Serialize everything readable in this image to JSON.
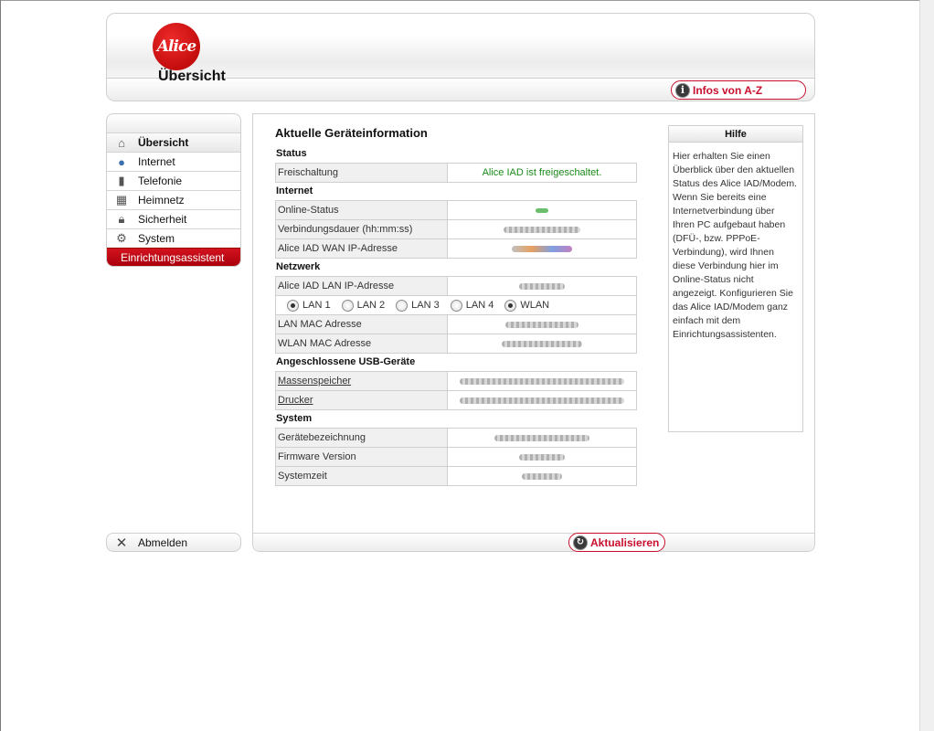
{
  "header": {
    "logo_text": "Alice",
    "page_title": "Übersicht",
    "infos_button": "Infos von A-Z"
  },
  "sidebar": {
    "items": [
      {
        "label": "Übersicht",
        "icon": "house-icon"
      },
      {
        "label": "Internet",
        "icon": "globe-icon"
      },
      {
        "label": "Telefonie",
        "icon": "phone-icon"
      },
      {
        "label": "Heimnetz",
        "icon": "network-icon"
      },
      {
        "label": "Sicherheit",
        "icon": "lock-icon"
      },
      {
        "label": "System",
        "icon": "gear-icon"
      }
    ],
    "assistant": "Einrichtungsassistent",
    "logout": "Abmelden"
  },
  "main": {
    "title": "Aktuelle Geräteinformation",
    "status": {
      "heading": "Status",
      "rows": [
        {
          "label": "Freischaltung",
          "value": "Alice IAD ist freigeschaltet."
        }
      ]
    },
    "internet": {
      "heading": "Internet",
      "rows": [
        {
          "label": "Online-Status"
        },
        {
          "label": "Verbindungsdauer (hh:mm:ss)"
        },
        {
          "label": "Alice IAD WAN IP-Adresse"
        }
      ]
    },
    "network": {
      "heading": "Netzwerk",
      "ip_label": "Alice IAD LAN IP-Adresse",
      "ports": [
        "LAN 1",
        "LAN 2",
        "LAN 3",
        "LAN 4",
        "WLAN"
      ],
      "selected_ports": [
        "LAN 1",
        "WLAN"
      ],
      "lan_mac": "LAN MAC Adresse",
      "wlan_mac": "WLAN MAC Adresse"
    },
    "usb": {
      "heading": "Angeschlossene USB-Geräte",
      "storage": "Massenspeicher",
      "printer": "Drucker"
    },
    "system": {
      "heading": "System",
      "rows": [
        {
          "label": "Gerätebezeichnung"
        },
        {
          "label": "Firmware Version"
        },
        {
          "label": "Systemzeit"
        }
      ]
    },
    "refresh_button": "Aktualisieren"
  },
  "help": {
    "title": "Hilfe",
    "text": "Hier erhalten Sie einen Überblick über den aktuellen Status des Alice IAD/Modem. Wenn Sie bereits eine Internetverbindung über Ihren PC aufgebaut haben (DFÜ-, bzw. PPPoE-Verbindung), wird Ihnen diese Verbindung hier im Online-Status nicht angezeigt. Konfigurieren Sie das Alice IAD/Modem ganz einfach mit dem Einrichtungsassistenten."
  },
  "colors": {
    "brand_red": "#c8102e",
    "ok_green": "#1a8a1a"
  }
}
